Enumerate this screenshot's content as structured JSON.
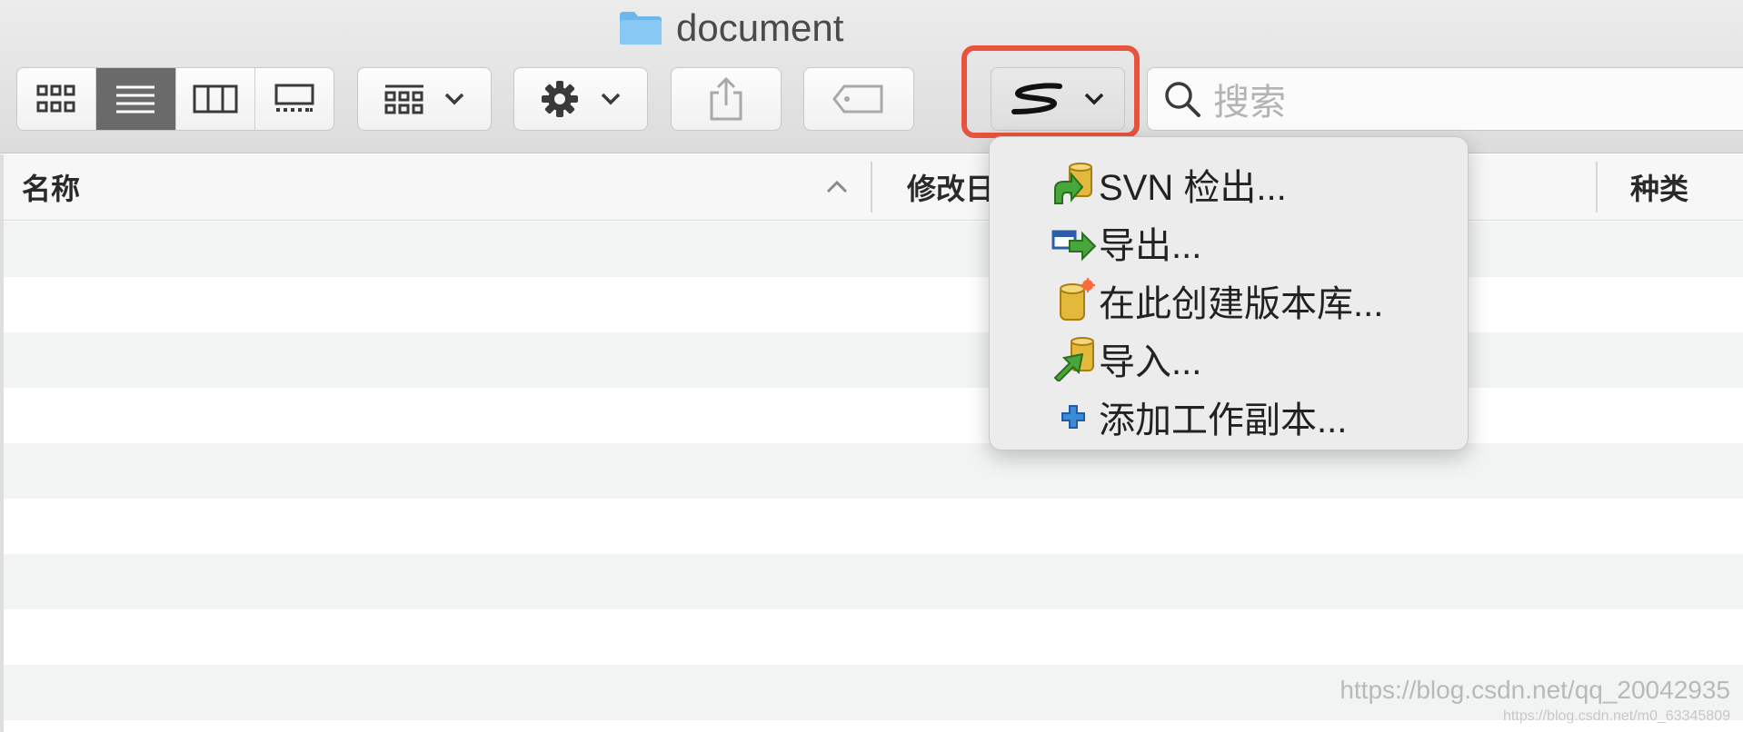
{
  "window": {
    "title": "document"
  },
  "toolbar": {
    "view_modes": [
      {
        "icon": "icon-view-icon",
        "active": false
      },
      {
        "icon": "list-view-icon",
        "active": true
      },
      {
        "icon": "column-view-icon",
        "active": false
      },
      {
        "icon": "gallery-view-icon",
        "active": false
      }
    ],
    "group_icon": "group-by-icon",
    "action_icon": "gear-icon",
    "share_icon": "share-icon",
    "tag_icon": "tag-icon",
    "svn_icon": "svn-logo-icon",
    "highlight_color": "#e8533d"
  },
  "search": {
    "placeholder": "搜索"
  },
  "table": {
    "columns": [
      "名称",
      "修改日",
      "种类"
    ]
  },
  "svn_menu": {
    "items": [
      {
        "label": "SVN 检出...",
        "icon": "svn-checkout-icon"
      },
      {
        "label": "导出...",
        "icon": "export-icon"
      },
      {
        "label": "在此创建版本库...",
        "icon": "create-repository-icon"
      },
      {
        "label": "导入...",
        "icon": "import-icon"
      },
      {
        "label": "添加工作副本...",
        "icon": "add-working-copy-icon"
      }
    ]
  },
  "watermark": {
    "line1": "https://blog.csdn.net/qq_20042935",
    "line2": "https://blog.csdn.net/m0_63345809"
  }
}
